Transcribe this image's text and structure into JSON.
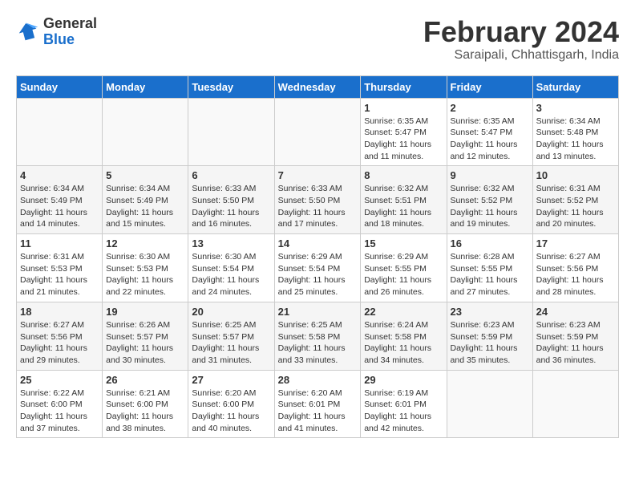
{
  "header": {
    "logo_general": "General",
    "logo_blue": "Blue",
    "month_year": "February 2024",
    "location": "Saraipali, Chhattisgarh, India"
  },
  "weekdays": [
    "Sunday",
    "Monday",
    "Tuesday",
    "Wednesday",
    "Thursday",
    "Friday",
    "Saturday"
  ],
  "weeks": [
    [
      {
        "day": "",
        "info": ""
      },
      {
        "day": "",
        "info": ""
      },
      {
        "day": "",
        "info": ""
      },
      {
        "day": "",
        "info": ""
      },
      {
        "day": "1",
        "info": "Sunrise: 6:35 AM\nSunset: 5:47 PM\nDaylight: 11 hours\nand 11 minutes."
      },
      {
        "day": "2",
        "info": "Sunrise: 6:35 AM\nSunset: 5:47 PM\nDaylight: 11 hours\nand 12 minutes."
      },
      {
        "day": "3",
        "info": "Sunrise: 6:34 AM\nSunset: 5:48 PM\nDaylight: 11 hours\nand 13 minutes."
      }
    ],
    [
      {
        "day": "4",
        "info": "Sunrise: 6:34 AM\nSunset: 5:49 PM\nDaylight: 11 hours\nand 14 minutes."
      },
      {
        "day": "5",
        "info": "Sunrise: 6:34 AM\nSunset: 5:49 PM\nDaylight: 11 hours\nand 15 minutes."
      },
      {
        "day": "6",
        "info": "Sunrise: 6:33 AM\nSunset: 5:50 PM\nDaylight: 11 hours\nand 16 minutes."
      },
      {
        "day": "7",
        "info": "Sunrise: 6:33 AM\nSunset: 5:50 PM\nDaylight: 11 hours\nand 17 minutes."
      },
      {
        "day": "8",
        "info": "Sunrise: 6:32 AM\nSunset: 5:51 PM\nDaylight: 11 hours\nand 18 minutes."
      },
      {
        "day": "9",
        "info": "Sunrise: 6:32 AM\nSunset: 5:52 PM\nDaylight: 11 hours\nand 19 minutes."
      },
      {
        "day": "10",
        "info": "Sunrise: 6:31 AM\nSunset: 5:52 PM\nDaylight: 11 hours\nand 20 minutes."
      }
    ],
    [
      {
        "day": "11",
        "info": "Sunrise: 6:31 AM\nSunset: 5:53 PM\nDaylight: 11 hours\nand 21 minutes."
      },
      {
        "day": "12",
        "info": "Sunrise: 6:30 AM\nSunset: 5:53 PM\nDaylight: 11 hours\nand 22 minutes."
      },
      {
        "day": "13",
        "info": "Sunrise: 6:30 AM\nSunset: 5:54 PM\nDaylight: 11 hours\nand 24 minutes."
      },
      {
        "day": "14",
        "info": "Sunrise: 6:29 AM\nSunset: 5:54 PM\nDaylight: 11 hours\nand 25 minutes."
      },
      {
        "day": "15",
        "info": "Sunrise: 6:29 AM\nSunset: 5:55 PM\nDaylight: 11 hours\nand 26 minutes."
      },
      {
        "day": "16",
        "info": "Sunrise: 6:28 AM\nSunset: 5:55 PM\nDaylight: 11 hours\nand 27 minutes."
      },
      {
        "day": "17",
        "info": "Sunrise: 6:27 AM\nSunset: 5:56 PM\nDaylight: 11 hours\nand 28 minutes."
      }
    ],
    [
      {
        "day": "18",
        "info": "Sunrise: 6:27 AM\nSunset: 5:56 PM\nDaylight: 11 hours\nand 29 minutes."
      },
      {
        "day": "19",
        "info": "Sunrise: 6:26 AM\nSunset: 5:57 PM\nDaylight: 11 hours\nand 30 minutes."
      },
      {
        "day": "20",
        "info": "Sunrise: 6:25 AM\nSunset: 5:57 PM\nDaylight: 11 hours\nand 31 minutes."
      },
      {
        "day": "21",
        "info": "Sunrise: 6:25 AM\nSunset: 5:58 PM\nDaylight: 11 hours\nand 33 minutes."
      },
      {
        "day": "22",
        "info": "Sunrise: 6:24 AM\nSunset: 5:58 PM\nDaylight: 11 hours\nand 34 minutes."
      },
      {
        "day": "23",
        "info": "Sunrise: 6:23 AM\nSunset: 5:59 PM\nDaylight: 11 hours\nand 35 minutes."
      },
      {
        "day": "24",
        "info": "Sunrise: 6:23 AM\nSunset: 5:59 PM\nDaylight: 11 hours\nand 36 minutes."
      }
    ],
    [
      {
        "day": "25",
        "info": "Sunrise: 6:22 AM\nSunset: 6:00 PM\nDaylight: 11 hours\nand 37 minutes."
      },
      {
        "day": "26",
        "info": "Sunrise: 6:21 AM\nSunset: 6:00 PM\nDaylight: 11 hours\nand 38 minutes."
      },
      {
        "day": "27",
        "info": "Sunrise: 6:20 AM\nSunset: 6:00 PM\nDaylight: 11 hours\nand 40 minutes."
      },
      {
        "day": "28",
        "info": "Sunrise: 6:20 AM\nSunset: 6:01 PM\nDaylight: 11 hours\nand 41 minutes."
      },
      {
        "day": "29",
        "info": "Sunrise: 6:19 AM\nSunset: 6:01 PM\nDaylight: 11 hours\nand 42 minutes."
      },
      {
        "day": "",
        "info": ""
      },
      {
        "day": "",
        "info": ""
      }
    ]
  ]
}
